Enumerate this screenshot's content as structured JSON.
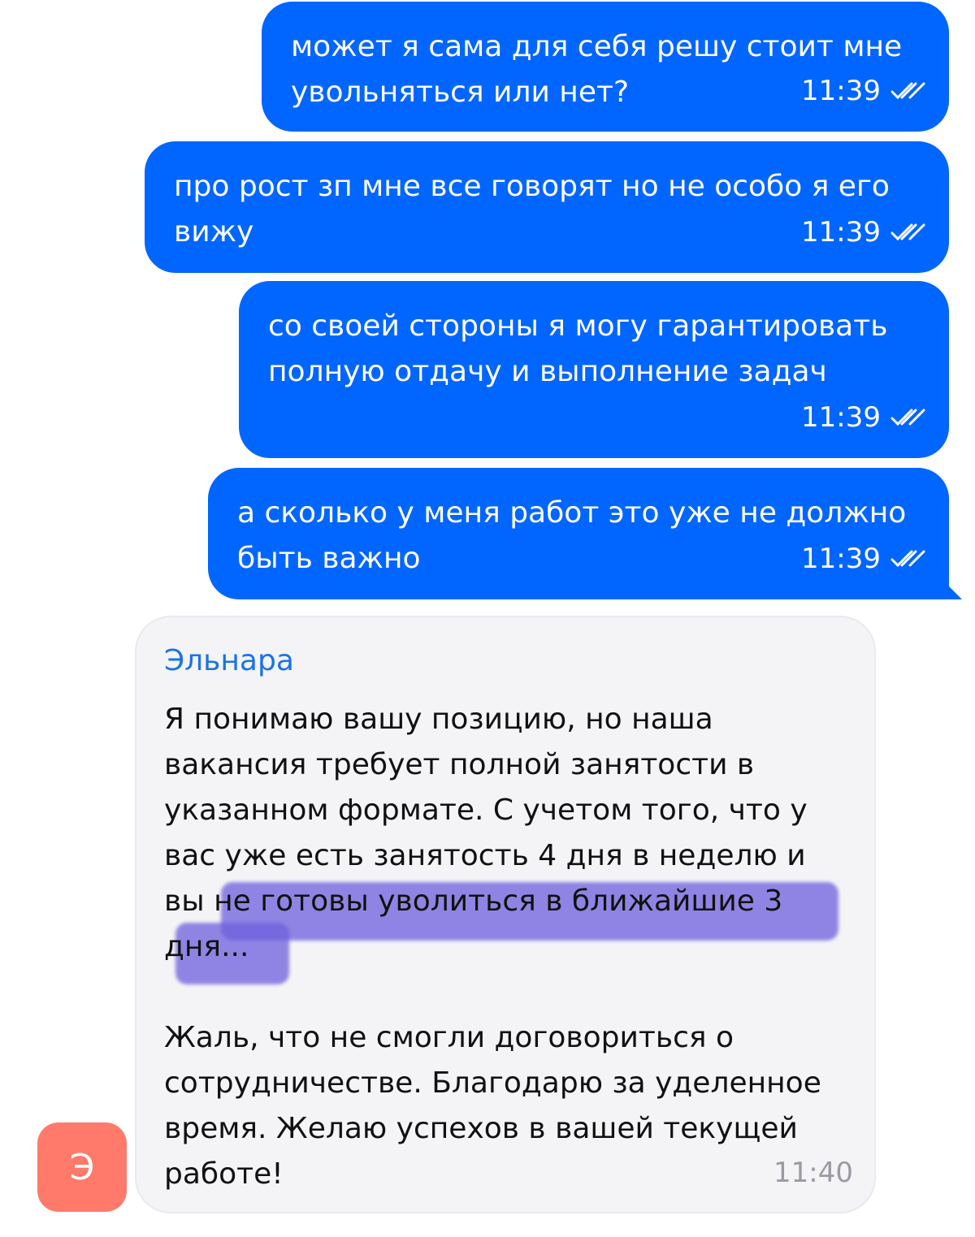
{
  "messages_out": [
    {
      "text": "может я сама для себя решу стоит мне увольняться или нет?",
      "time": "11:39"
    },
    {
      "text": "про рост зп мне все говорят но не особо я его вижу",
      "time": "11:39"
    },
    {
      "text": "со своей стороны я могу гарантировать полную отдачу и выполнение задач",
      "time": "11:39"
    },
    {
      "text": "а сколько у меня работ это уже не должно быть важно",
      "time": "11:39"
    }
  ],
  "message_in": {
    "sender": "Эльнара",
    "paragraph_1": "Я понимаю вашу позицию, но наша вакансия требует полной занятости в указанном формате. С учетом того, что у вас уже есть занятость 4 дня в неделю и вы не готовы уволиться в ближайшие 3 дня...",
    "paragraph_2": "Жаль, что не смогли договориться о сотрудничестве. Благодарю за уделенное время. Желаю успехов в вашей текущей работе!",
    "time": "11:40"
  },
  "avatar": {
    "letter": "Э",
    "color": "#ff7a6b"
  },
  "colors": {
    "outgoing_bubble": "#0066ff",
    "incoming_bubble": "#f4f4f6",
    "sender_name": "#1a73e8",
    "highlight": "#6e5fdc"
  },
  "icons": {
    "read_status": "double-check-icon"
  }
}
